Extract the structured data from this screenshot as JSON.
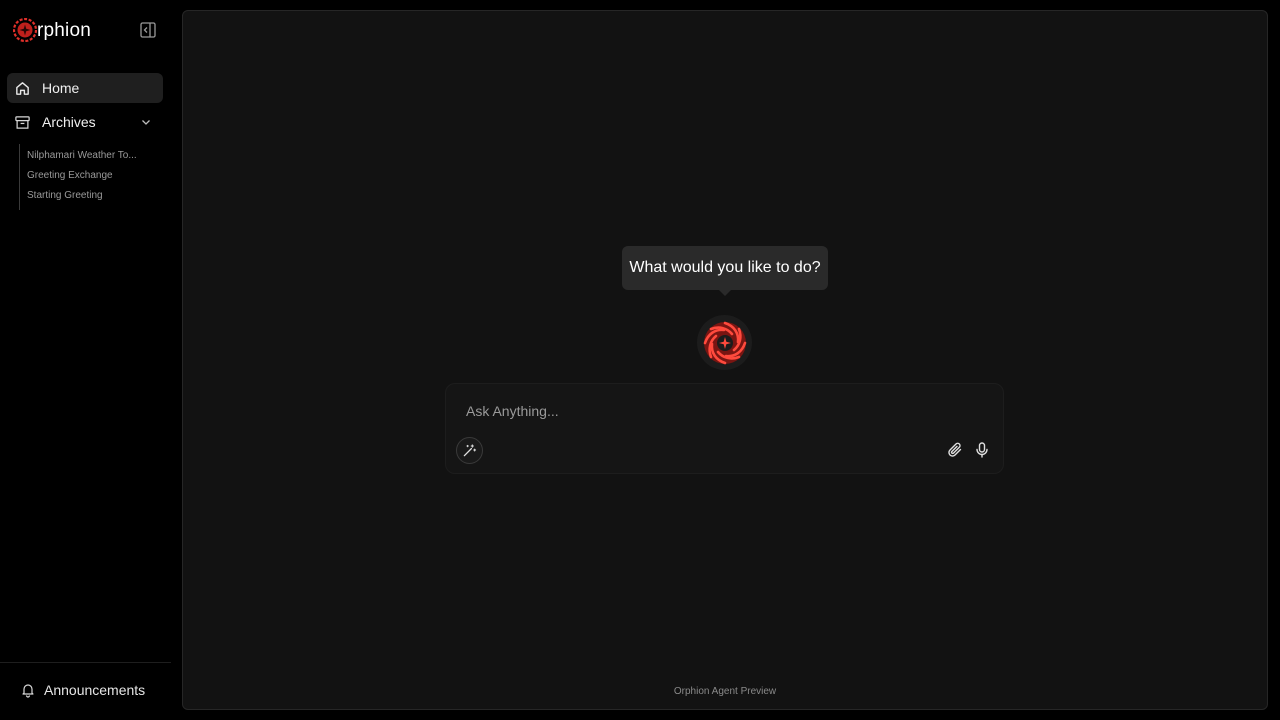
{
  "brand": {
    "name": "rphion",
    "accent": "#e0302a"
  },
  "sidebar": {
    "nav": [
      {
        "label": "Home",
        "icon": "home-icon",
        "active": true
      },
      {
        "label": "Archives",
        "icon": "archive-icon",
        "expanded": true
      }
    ],
    "archives": [
      "Nilphamari Weather To...",
      "Greeting Exchange",
      "Starting Greeting"
    ],
    "announcements_label": "Announcements"
  },
  "main": {
    "prompt_bubble": "What would you like to do?",
    "composer": {
      "placeholder": "Ask Anything..."
    },
    "footer": "Orphion Agent Preview"
  }
}
